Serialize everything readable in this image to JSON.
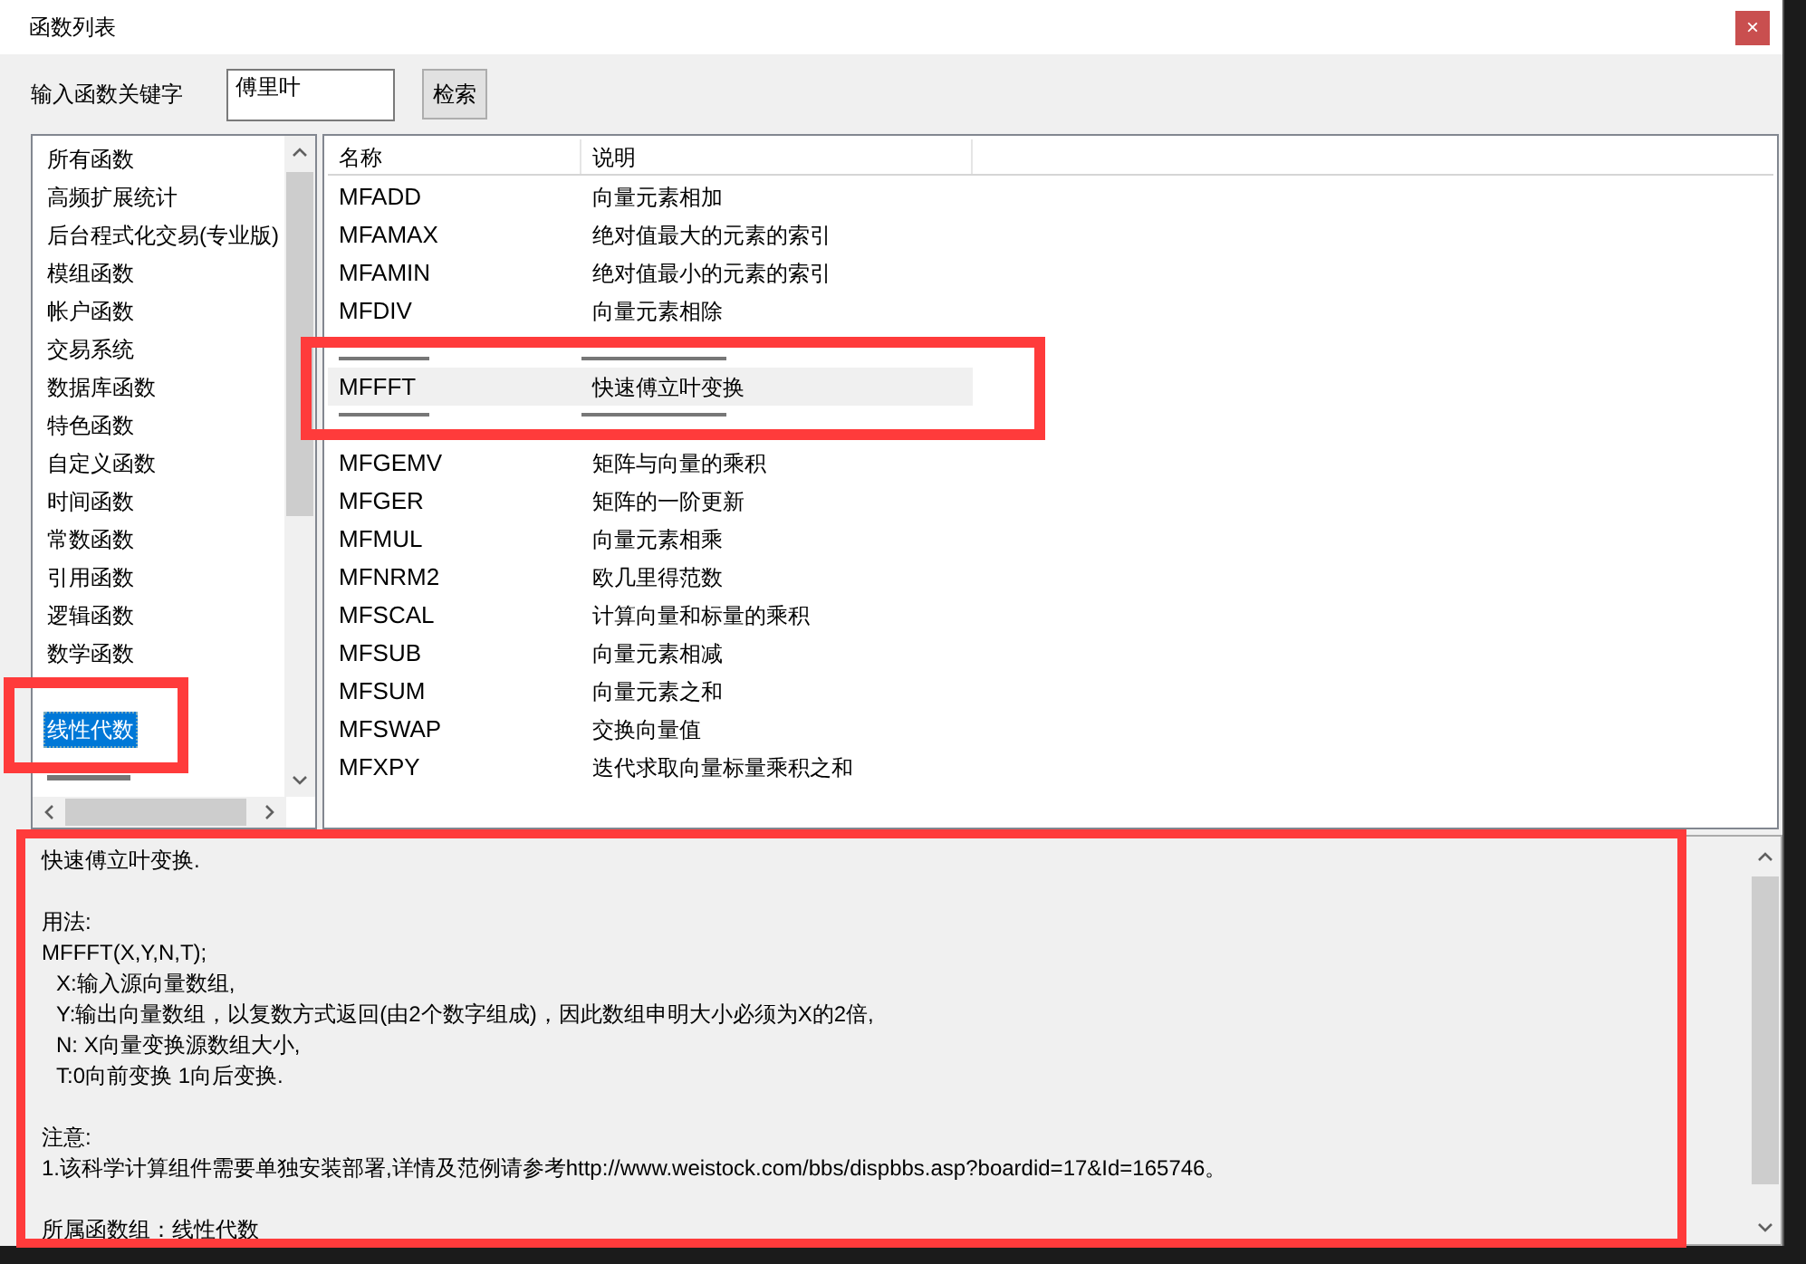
{
  "window": {
    "title": "函数列表",
    "close": "×"
  },
  "search": {
    "label": "输入函数关键字",
    "value": "傅里叶",
    "button": "检索"
  },
  "categories": [
    {
      "label": "所有函数",
      "selected": false
    },
    {
      "label": "高频扩展统计",
      "selected": false
    },
    {
      "label": "后台程式化交易(专业版)",
      "selected": false
    },
    {
      "label": "模组函数",
      "selected": false
    },
    {
      "label": "帐户函数",
      "selected": false
    },
    {
      "label": "交易系统",
      "selected": false
    },
    {
      "label": "数据库函数",
      "selected": false
    },
    {
      "label": "特色函数",
      "selected": false
    },
    {
      "label": "自定义函数",
      "selected": false
    },
    {
      "label": "时间函数",
      "selected": false
    },
    {
      "label": "常数函数",
      "selected": false
    },
    {
      "label": "引用函数",
      "selected": false
    },
    {
      "label": "逻辑函数",
      "selected": false
    },
    {
      "label": "数学函数",
      "selected": false
    },
    {
      "kind": "covered"
    },
    {
      "label": "线性代数",
      "selected": true
    },
    {
      "kind": "covered"
    },
    {
      "kind": "covered"
    }
  ],
  "table": {
    "columns": [
      "名称",
      "说明"
    ],
    "rows": [
      {
        "name": "MFADD",
        "desc": "向量元素相加",
        "selected": false
      },
      {
        "name": "MFAMAX",
        "desc": "绝对值最大的元素的索引",
        "selected": false
      },
      {
        "name": "MFAMIN",
        "desc": "绝对值最小的元素的索引",
        "selected": false
      },
      {
        "name": "MFDIV",
        "desc": "向量元素相除",
        "selected": false
      },
      {
        "kind": "covered"
      },
      {
        "name": "MFFFT",
        "desc": "快速傅立叶变换",
        "selected": true
      },
      {
        "kind": "covered"
      },
      {
        "name": "MFGEMV",
        "desc": "矩阵与向量的乘积",
        "selected": false
      },
      {
        "name": "MFGER",
        "desc": "矩阵的一阶更新",
        "selected": false
      },
      {
        "name": "MFMUL",
        "desc": "向量元素相乘",
        "selected": false
      },
      {
        "name": "MFNRM2",
        "desc": "欧几里得范数",
        "selected": false
      },
      {
        "name": "MFSCAL",
        "desc": "计算向量和标量的乘积",
        "selected": false
      },
      {
        "name": "MFSUB",
        "desc": "向量元素相减",
        "selected": false
      },
      {
        "name": "MFSUM",
        "desc": "向量元素之和",
        "selected": false
      },
      {
        "name": "MFSWAP",
        "desc": "交换向量值",
        "selected": false
      },
      {
        "name": "MFXPY",
        "desc": "迭代求取向量标量乘积之和",
        "selected": false
      }
    ]
  },
  "description": {
    "paragraphs": [
      [
        {
          "text": "快速傅立叶变换.",
          "indent": false
        }
      ],
      [
        {
          "text": "用法:",
          "indent": false
        },
        {
          "text": "MFFFT(X,Y,N,T);",
          "indent": false
        },
        {
          "text": "X:输入源向量数组,",
          "indent": true
        },
        {
          "text": "Y:输出向量数组，以复数方式返回(由2个数字组成)，因此数组申明大小必须为X的2倍,",
          "indent": true
        },
        {
          "text": "N: X向量变换源数组大小,",
          "indent": true
        },
        {
          "text": "T:0向前变换 1向后变换.",
          "indent": true
        }
      ],
      [
        {
          "text": "注意:",
          "indent": false
        },
        {
          "text": "1.该科学计算组件需要单独安装部署,详情及范例请参考http://www.weistock.com/bbs/dispbbs.asp?boardid=17&Id=165746。",
          "indent": false
        }
      ],
      [
        {
          "text": "所属函数组：线性代数",
          "indent": false
        }
      ]
    ]
  }
}
